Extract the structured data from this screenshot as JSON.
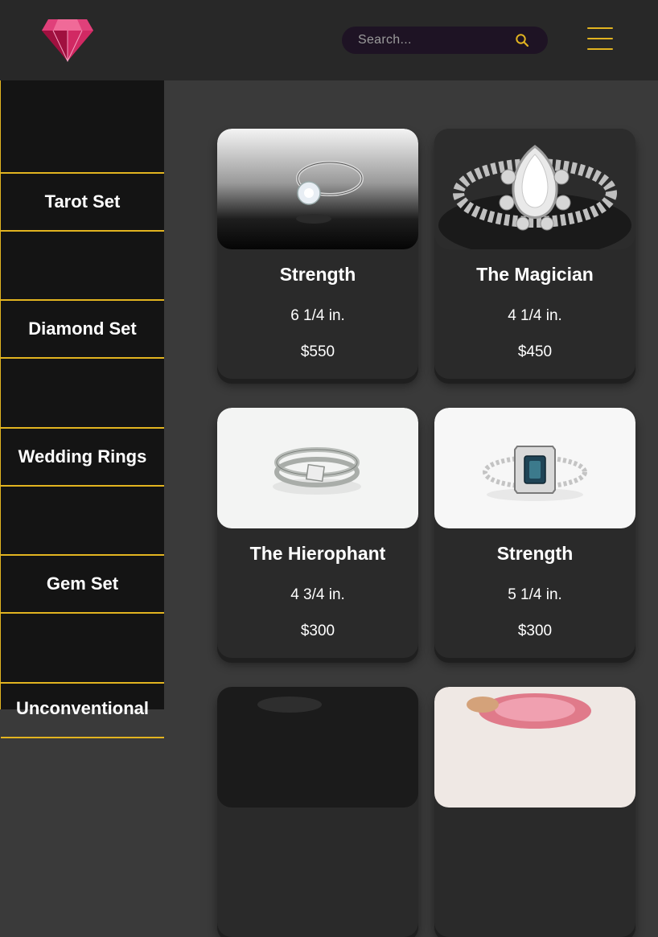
{
  "header": {
    "logo_icon": "ruby-gem-icon",
    "search": {
      "placeholder": "Search...",
      "icon": "search-icon"
    },
    "menu_icon": "hamburger-menu-icon"
  },
  "sidebar": {
    "items": [
      {
        "label": "Tarot Set"
      },
      {
        "label": "Diamond Set"
      },
      {
        "label": "Wedding Rings"
      },
      {
        "label": "Gem Set"
      },
      {
        "label": "Unconventional"
      }
    ]
  },
  "products": [
    {
      "title": "Strength",
      "size": "6 1/4 in.",
      "price": "$550",
      "image": "solitaire-ring-photo"
    },
    {
      "title": "The Magician",
      "size": "4 1/4 in.",
      "price": "$450",
      "image": "pear-halo-ring-photo"
    },
    {
      "title": "The Hierophant",
      "size": "4 3/4 in.",
      "price": "$300",
      "image": "princess-cut-bridal-set-photo"
    },
    {
      "title": "Strength",
      "size": "5 1/4 in.",
      "price": "$300",
      "image": "sapphire-halo-ring-photo"
    },
    {
      "title": "",
      "size": "",
      "price": "",
      "image": "dark-ring-photo"
    },
    {
      "title": "",
      "size": "",
      "price": "",
      "image": "pink-gem-ring-photo"
    }
  ],
  "colors": {
    "accent": "#e2b420",
    "header_bg": "#282828",
    "sidebar_bg": "#141414",
    "content_bg": "#3a3a3a",
    "card_bg": "#2a2a2a",
    "gem": "#c0245a"
  }
}
